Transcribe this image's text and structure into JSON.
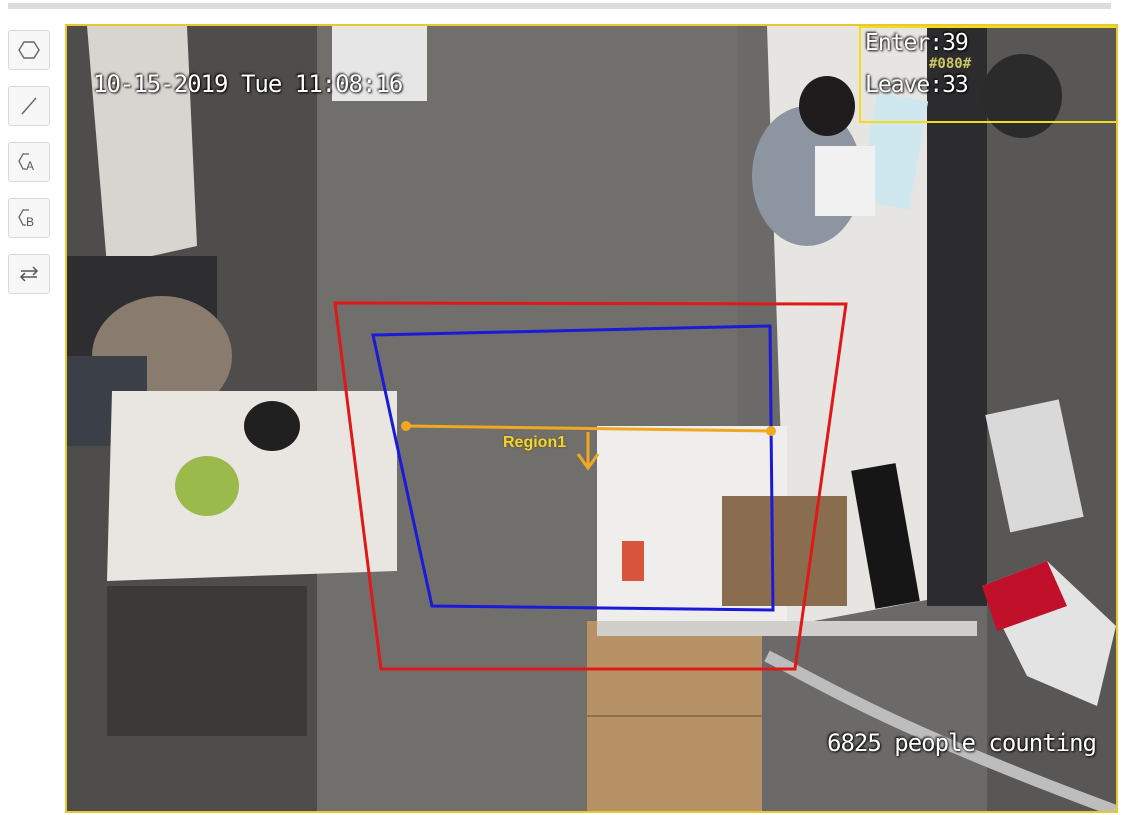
{
  "toolbar": {
    "tools": [
      {
        "name": "polygon-tool",
        "icon": "hexagon-icon"
      },
      {
        "name": "line-tool",
        "icon": "line-icon"
      },
      {
        "name": "region-a-tool",
        "icon": "region-a-icon",
        "letter": "A"
      },
      {
        "name": "region-b-tool",
        "icon": "region-b-icon",
        "letter": "B"
      },
      {
        "name": "swap-direction-tool",
        "icon": "swap-arrows-icon"
      }
    ]
  },
  "video": {
    "timestamp": "10-15-2019 Tue 11:08:16",
    "enter_label": "Enter:39",
    "leave_label": "Leave:33",
    "watermark": "#080#",
    "caption": "6825 people counting",
    "region_label": "Region1"
  },
  "colors": {
    "frame_border": "#e8c830",
    "count_box": "#f2dd18",
    "outer_region": "#e01818",
    "inner_region": "#1a1ad8",
    "tripwire": "#f0a820",
    "region_label": "#f3d23a"
  }
}
